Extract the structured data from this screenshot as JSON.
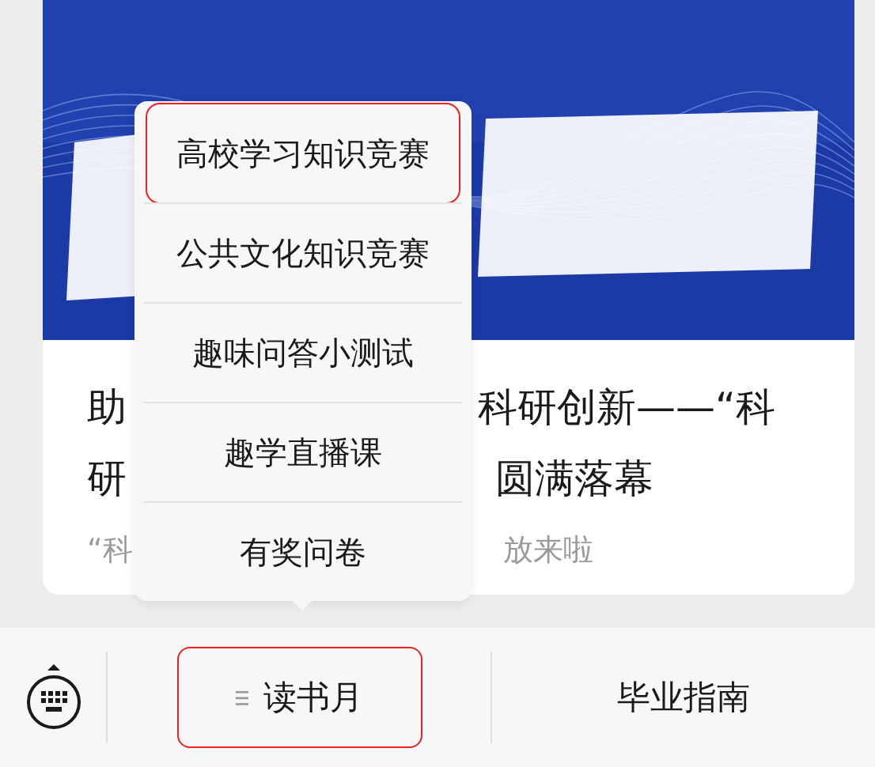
{
  "article": {
    "title_lines": [
      {
        "start": "助",
        "end": "科研创新——“科"
      },
      {
        "start": "研",
        "end": "圆满落幕"
      }
    ],
    "summary": {
      "start": "“科",
      "end": "放来啦"
    }
  },
  "popup_menu": {
    "items": [
      {
        "label": "高校学习知识竞赛",
        "highlighted": true
      },
      {
        "label": "公共文化知识竞赛",
        "highlighted": false
      },
      {
        "label": "趣味问答小测试",
        "highlighted": false
      },
      {
        "label": "趣学直播课",
        "highlighted": false
      },
      {
        "label": "有奖问卷",
        "highlighted": false
      }
    ]
  },
  "bottom_bar": {
    "items": [
      {
        "label": "读书月",
        "has_submenu": true,
        "highlighted": true
      },
      {
        "label": "毕业指南",
        "has_submenu": false,
        "highlighted": false
      }
    ]
  }
}
